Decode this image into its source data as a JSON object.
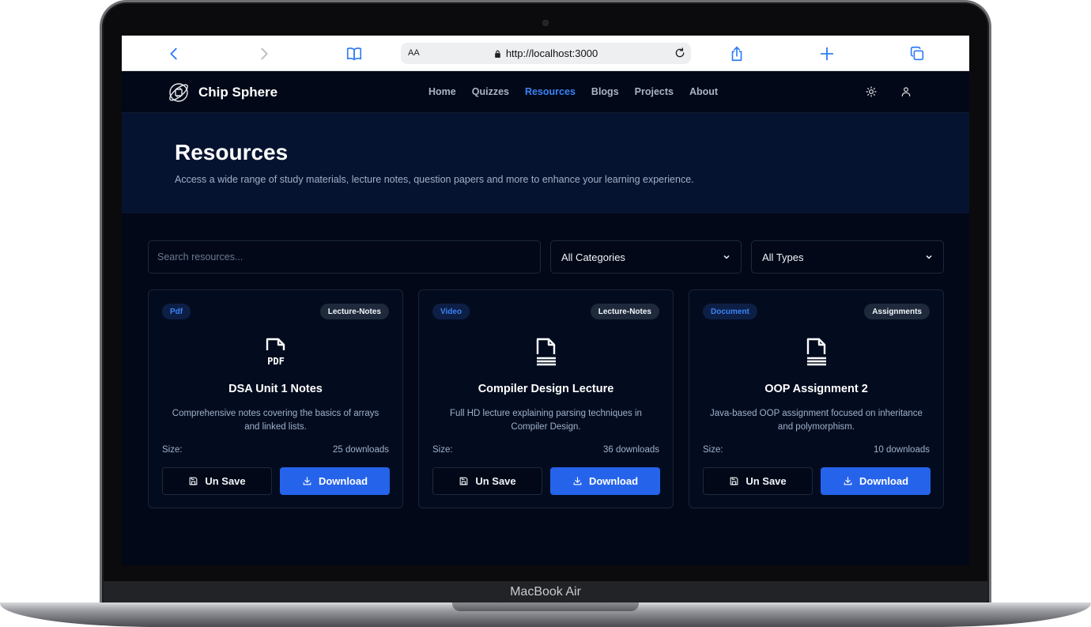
{
  "device": {
    "label": "MacBook Air"
  },
  "browser": {
    "text_size_label": "AA",
    "url": "http://localhost:3000"
  },
  "brand": {
    "name": "Chip Sphere"
  },
  "nav": {
    "links": [
      "Home",
      "Quizzes",
      "Resources",
      "Blogs",
      "Projects",
      "About"
    ],
    "active": "Resources"
  },
  "hero": {
    "title": "Resources",
    "subtitle": "Access a wide range of study materials, lecture notes, question papers and more to enhance your learning experience."
  },
  "filters": {
    "search_placeholder": "Search resources...",
    "category_selected": "All Categories",
    "type_selected": "All Types"
  },
  "colors": {
    "accent": "#3b82f6",
    "primary_button": "#2563eb",
    "background": "#020817",
    "hero_background": "#061330"
  },
  "cards": [
    {
      "type": "Pdf",
      "category": "Lecture-Notes",
      "icon": "pdf-file-icon",
      "title": "DSA Unit 1 Notes",
      "description": "Comprehensive notes covering the basics of arrays and linked lists.",
      "size_label": "Size:",
      "downloads": "25 downloads",
      "unsave_label": "Un Save",
      "download_label": "Download"
    },
    {
      "type": "Video",
      "category": "Lecture-Notes",
      "icon": "document-file-icon",
      "title": "Compiler Design Lecture",
      "description": "Full HD lecture explaining parsing techniques in Compiler Design.",
      "size_label": "Size:",
      "downloads": "36 downloads",
      "unsave_label": "Un Save",
      "download_label": "Download"
    },
    {
      "type": "Document",
      "category": "Assignments",
      "icon": "document-file-icon",
      "title": "OOP Assignment 2",
      "description": "Java-based OOP assignment focused on inheritance and polymorphism.",
      "size_label": "Size:",
      "downloads": "10 downloads",
      "unsave_label": "Un Save",
      "download_label": "Download"
    }
  ]
}
